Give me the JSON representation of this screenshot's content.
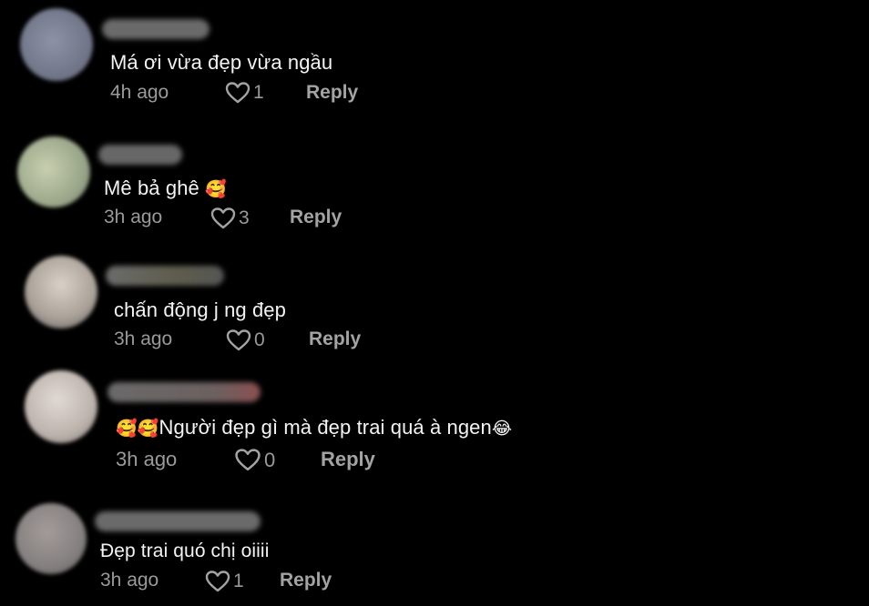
{
  "comments": [
    {
      "text": "Má ơi vừa đẹp vừa ngầu",
      "emoji_before": "",
      "emoji_after": "",
      "time": "4h ago",
      "likes": "1",
      "reply": "Reply",
      "avatar_color": "#7f8497"
    },
    {
      "text": "Mê bả ghê ",
      "emoji_before": "",
      "emoji_after": "🥰",
      "time": "3h ago",
      "likes": "3",
      "reply": "Reply",
      "avatar_color": "#a8b49a"
    },
    {
      "text": "chấn động j ng đẹp",
      "emoji_before": "",
      "emoji_after": "",
      "time": "3h ago",
      "likes": "0",
      "reply": "Reply",
      "avatar_color": "#b9b2aa"
    },
    {
      "text": "Người đẹp gì mà đẹp trai quá à ngen",
      "emoji_before": "🥰🥰",
      "emoji_after": "😂",
      "time": "3h ago",
      "likes": "0",
      "reply": "Reply",
      "avatar_color": "#c4bcb8"
    },
    {
      "text": "Đẹp trai quó chị oiiii",
      "emoji_before": "",
      "emoji_after": "",
      "time": "3h ago",
      "likes": "1",
      "reply": "Reply",
      "avatar_color": "#8e8785"
    }
  ]
}
